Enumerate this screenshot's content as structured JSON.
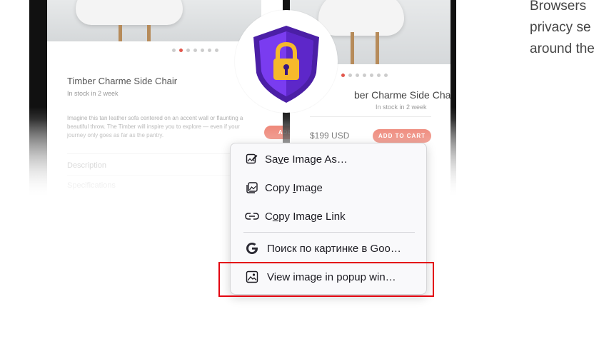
{
  "product_left": {
    "title": "Timber Charme Side Chair",
    "stock": "In stock in 2 week",
    "description": "Imagine this tan leather sofa centered on an accent wall or flaunting a beautiful throw. The Timber will inspire you to explore — even if your journey only goes as far as the pantry.",
    "button_partial": "ADD",
    "tab_description": "Description",
    "tab_specifications": "Specifications"
  },
  "product_right": {
    "title": "ber Charme Side Chair",
    "stock": "In stock in 2 week",
    "price": "$199 USD",
    "button": "ADD TO CART"
  },
  "side_text": {
    "line1": "Browsers",
    "line2": "privacy se",
    "line3": "around the"
  },
  "context_menu": {
    "items": [
      {
        "label_pre": "Sa",
        "label_u": "v",
        "label_post": "e Image As…",
        "icon": "save-image-icon"
      },
      {
        "label_pre": "Copy ",
        "label_u": "I",
        "label_post": "mage",
        "icon": "copy-image-icon"
      },
      {
        "label_pre": "C",
        "label_u": "o",
        "label_post": "py Image Link",
        "icon": "link-icon"
      },
      {
        "label": "Поиск по картинке в Goo…",
        "icon": "google-icon"
      },
      {
        "label": "View image in popup win…",
        "icon": "popup-image-icon"
      }
    ]
  },
  "colors": {
    "highlight": "#e3000f",
    "cart_button": "#ea6a58",
    "shield_purple": "#6a2bd8",
    "lock_yellow": "#f6b92b"
  }
}
